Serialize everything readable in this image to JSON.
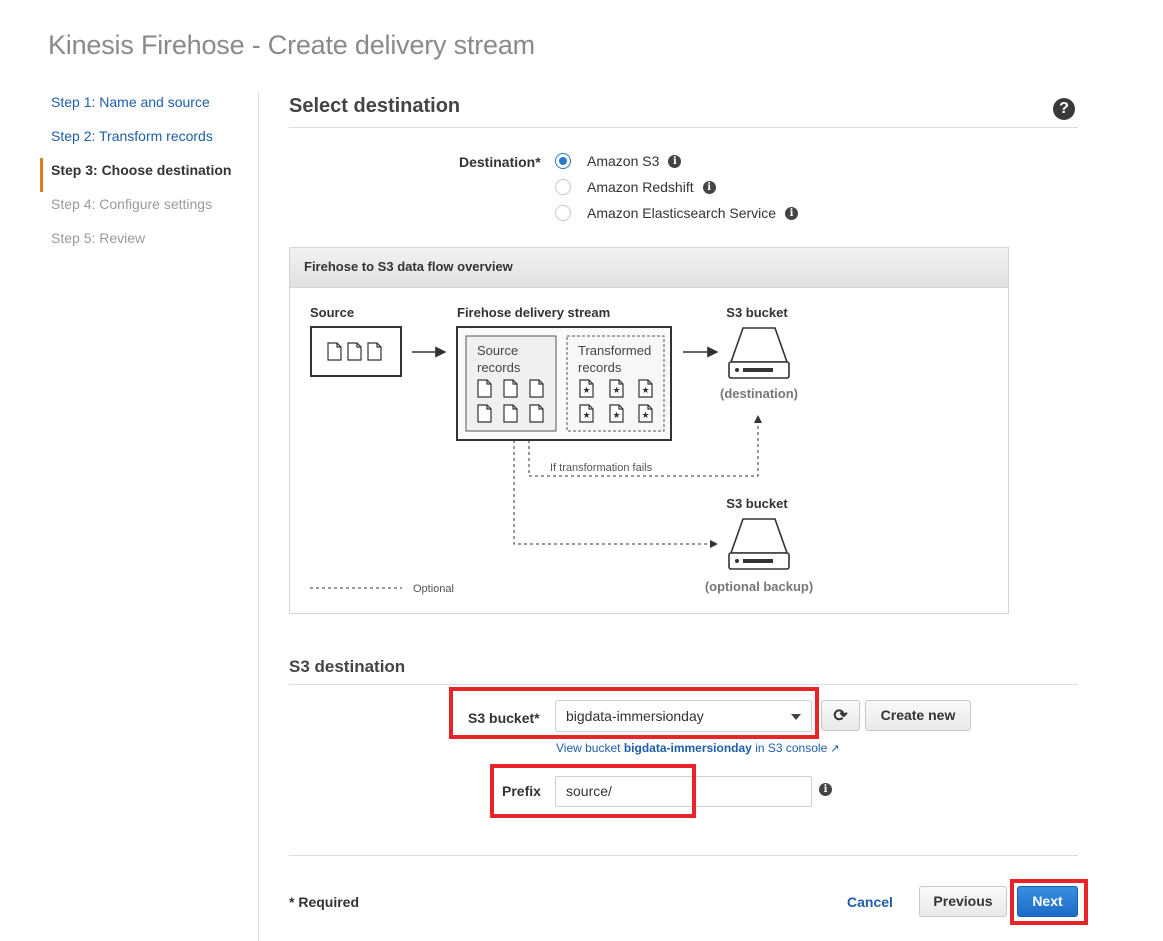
{
  "page": {
    "title": "Kinesis Firehose - Create delivery stream"
  },
  "steps": [
    {
      "label": "Step 1: Name and source",
      "state": "link"
    },
    {
      "label": "Step 2: Transform records",
      "state": "link"
    },
    {
      "label": "Step 3: Choose destination",
      "state": "active"
    },
    {
      "label": "Step 4: Configure settings",
      "state": "disabled"
    },
    {
      "label": "Step 5: Review",
      "state": "disabled"
    }
  ],
  "select_destination": {
    "title": "Select destination",
    "help_icon": "question-circle-icon",
    "destination_label": "Destination*",
    "options": [
      {
        "label": "Amazon S3",
        "checked": true
      },
      {
        "label": "Amazon Redshift",
        "checked": false
      },
      {
        "label": "Amazon Elasticsearch Service",
        "checked": false
      }
    ]
  },
  "flow": {
    "header": "Firehose to S3 data flow overview",
    "source": "Source",
    "stream": "Firehose delivery stream",
    "source_records_1": "Source",
    "source_records_2": "records",
    "transformed_1": "Transformed",
    "transformed_2": "records",
    "s3_bucket": "S3 bucket",
    "destination": "(destination)",
    "fail_label": "If transformation fails",
    "s3_bucket_backup": "S3 bucket",
    "backup": "(optional backup)",
    "optional": "Optional"
  },
  "s3_destination": {
    "title": "S3 destination",
    "bucket_label": "S3 bucket*",
    "bucket_value": "bigdata-immersionday",
    "create_new": "Create new",
    "view_prefix": "View bucket ",
    "view_bucket": "bigdata-immersionday",
    "view_suffix": " in S3 console",
    "prefix_label": "Prefix",
    "prefix_value": "source/"
  },
  "footer": {
    "required": "* Required",
    "cancel": "Cancel",
    "previous": "Previous",
    "next": "Next"
  },
  "colors": {
    "link": "#1f5ea8",
    "active_step_marker": "#e27b1b",
    "primary_button": "#1c6cc8",
    "highlight": "#e8242b"
  }
}
